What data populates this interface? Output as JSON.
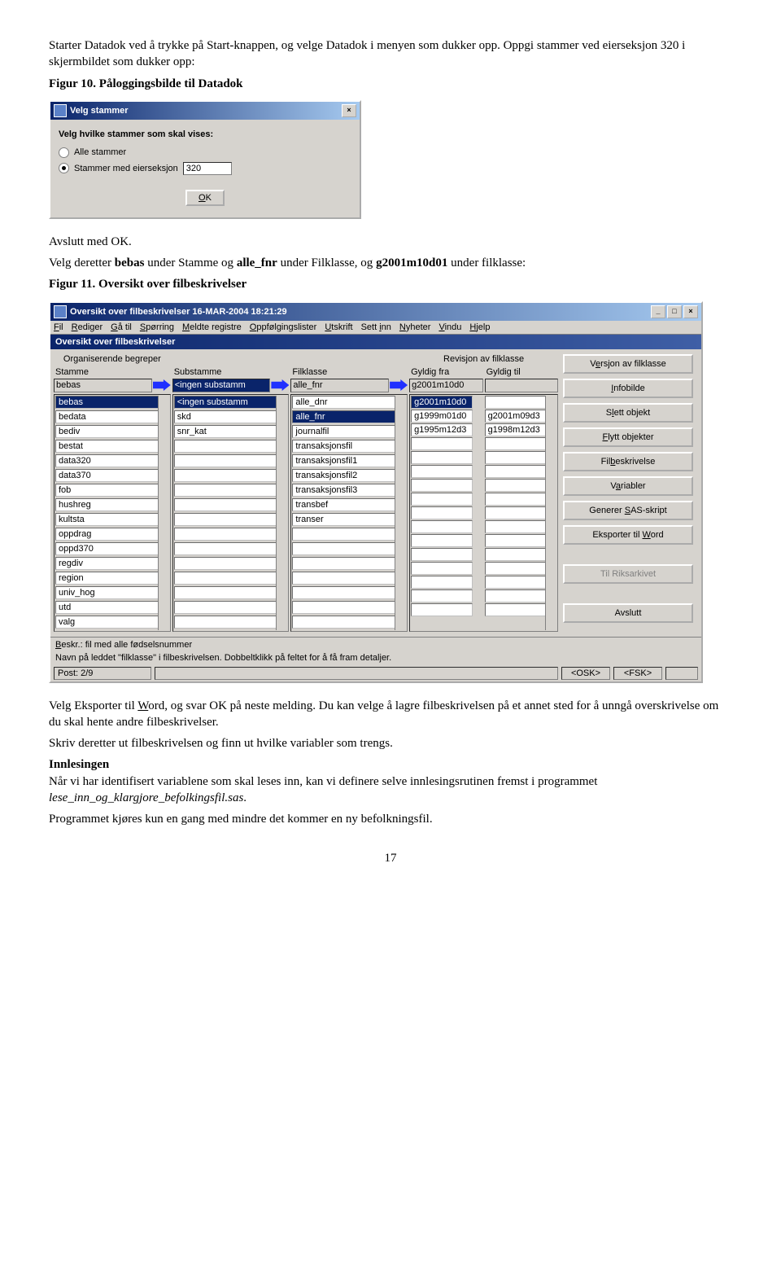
{
  "doc": {
    "p1_a": "Starter Datadok ved å trykke på Start-knappen, og velge Datadok i menyen som dukker opp. Oppgi stammer ved eierseksjon 320 i skjermbildet som dukker opp:",
    "p1_b": "Figur 10. Påloggingsbilde til Datadok",
    "p2": "Avslutt med OK.",
    "p3_a": "Velg deretter ",
    "p3_b": "bebas",
    "p3_c": " under Stamme og ",
    "p3_d": "alle_fnr",
    "p3_e": " under Filklasse, og ",
    "p3_f": "g2001m10d01",
    "p3_g": " under filklasse:",
    "p4": "Figur 11. Oversikt over filbeskrivelser",
    "p5_a": "Velg Eksporter til ",
    "p5_b": "W",
    "p5_c": "ord, og svar OK på neste melding. Du kan velge å lagre filbeskrivelsen på et annet sted for å unngå overskrivelse om du skal hente andre filbeskrivelser.",
    "p6": "Skriv deretter ut filbeskrivelsen og finn ut hvilke variabler som trengs.",
    "p7_h": "Innlesingen",
    "p7_a": "Når vi har identifisert variablene som skal leses inn, kan vi definere selve innlesingsrutinen fremst i programmet ",
    "p7_b": "lese_inn_og_klargjore_befolkingsfil.sas",
    "p7_c": ".",
    "p8": "Programmet kjøres kun en gang med mindre det kommer en ny befolkningsfil.",
    "pgnum": "17"
  },
  "velg": {
    "title": "Velg stammer",
    "heading": "Velg hvilke stammer som skal vises:",
    "r1": "Alle stammer",
    "r2": "Stammer med eierseksjon",
    "r2_val": "320",
    "ok_label": "OK",
    "ok_u": "O"
  },
  "over": {
    "title": "Oversikt over filbeskrivelser 16-MAR-2004 18:21:29",
    "menu": [
      "Fil",
      "Rediger",
      "Gå til",
      "Spørring",
      "Meldte registre",
      "Oppfølgingslister",
      "Utskrift",
      "Sett inn",
      "Nyheter",
      "Vindu",
      "Hjelp"
    ],
    "bluebar": "Oversikt over filbeskrivelser",
    "group1": "Organiserende begreper",
    "group2": "Revisjon av filklasse",
    "h_stamme": "Stamme",
    "h_sub": "Substamme",
    "h_fil": "Filklasse",
    "h_gfra": "Gyldig fra",
    "h_gtil": "Gyldig til",
    "sel_stamme": "bebas",
    "sel_sub": "<ingen substamm",
    "sel_fil": "alle_fnr",
    "sel_gfra": "g2001m10d0",
    "sel_gtil": "",
    "stamme_list": [
      "bebas",
      "bedata",
      "bediv",
      "bestat",
      "data320",
      "data370",
      "fob",
      "hushreg",
      "kultsta",
      "oppdrag",
      "oppd370",
      "regdiv",
      "region",
      "univ_hog",
      "utd",
      "valg"
    ],
    "sub_list": [
      "<ingen substamm",
      "skd",
      "snr_kat"
    ],
    "fil_list": [
      "alle_dnr",
      "alle_fnr",
      "journalfil",
      "transaksjonsfil",
      "transaksjonsfil1",
      "transaksjonsfil2",
      "transaksjonsfil3",
      "transbef",
      "transer"
    ],
    "rev_fra": [
      "g2001m10d0",
      "g1999m01d0",
      "g1995m12d3"
    ],
    "rev_til": [
      "",
      "g2001m09d3",
      "g1998m12d3"
    ],
    "rbtns": [
      "Versjon av filklasse",
      "Infobilde",
      "Slett objekt",
      "Flytt objekter",
      "Filbeskrivelse",
      "Variabler",
      "Generer SAS-skript",
      "Eksporter til Word"
    ],
    "rbtn_riks": "Til Riksarkivet",
    "rbtn_avslutt": "Avslutt",
    "status1": "Beskr.: fil med alle fødselsnummer",
    "status2": "Navn på leddet \"filklasse\" i filbeskrivelsen.  Dobbeltklikk på feltet for å få fram detaljer.",
    "status_post": "Post: 2/9",
    "status_osk": "<OSK>",
    "status_fsk": "<FSK>"
  }
}
